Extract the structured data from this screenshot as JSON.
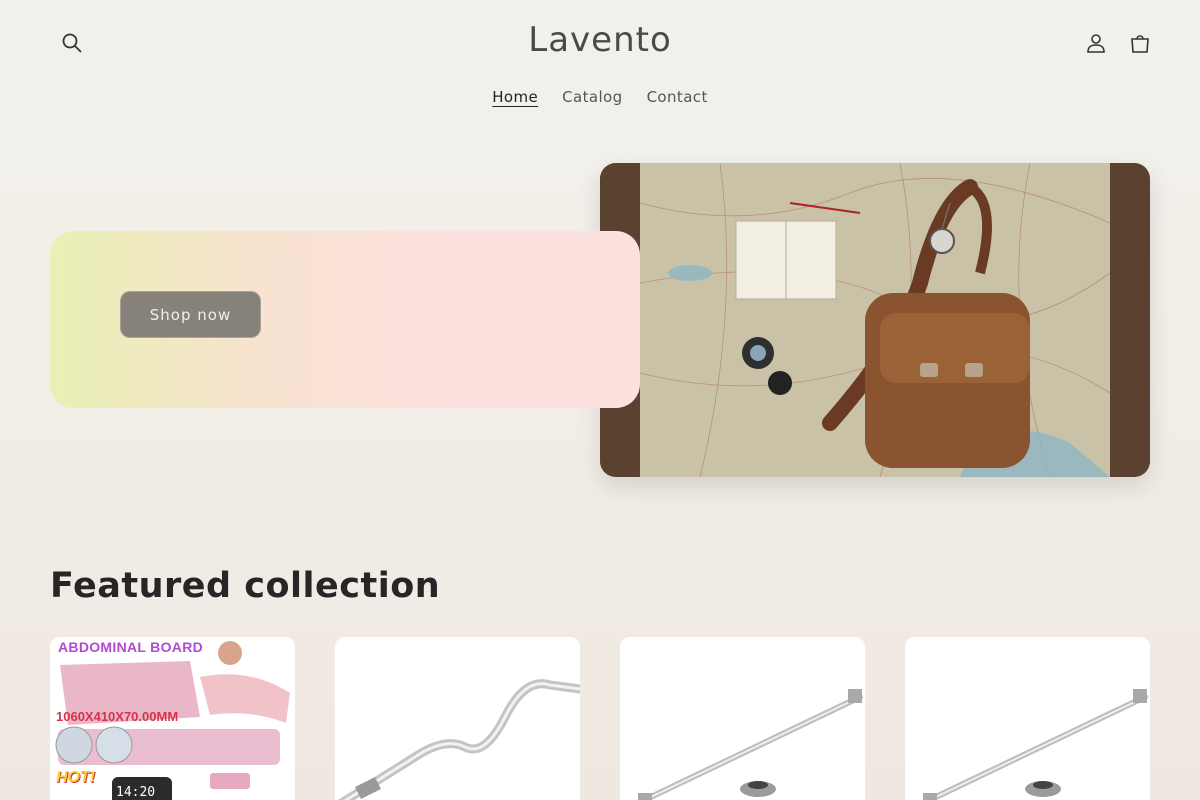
{
  "header": {
    "logo": "Lavento",
    "nav": [
      {
        "label": "Home",
        "active": true
      },
      {
        "label": "Catalog",
        "active": false
      },
      {
        "label": "Contact",
        "active": false
      }
    ],
    "icons": [
      "search-icon",
      "account-icon",
      "cart-icon"
    ]
  },
  "hero": {
    "button_label": "Shop now"
  },
  "featured": {
    "title": "Featured collection",
    "products": [
      {
        "image_text": "ABDOMINAL BOARD",
        "image_dims": "1060X410X70.00MM",
        "image_badge": "HOT!",
        "image_clock": "14:20"
      },
      {},
      {},
      {}
    ]
  },
  "colors": {
    "background": "#f1ede6",
    "button": "#86827a",
    "text_dark": "#262626"
  }
}
